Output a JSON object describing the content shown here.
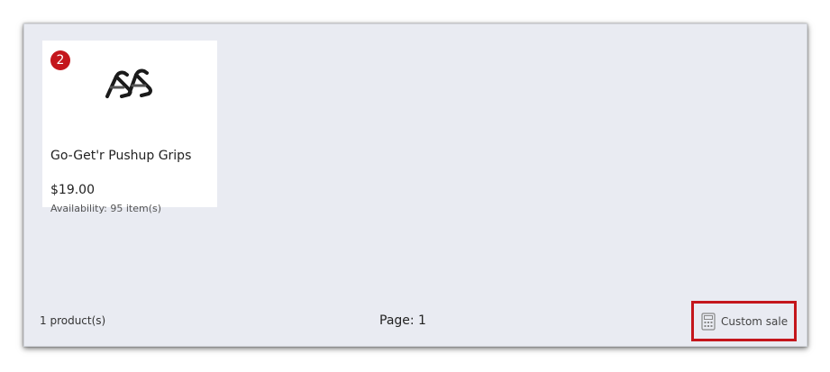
{
  "product": {
    "badge_count": "2",
    "name": "Go-Get'r Pushup Grips",
    "price": "$19.00",
    "availability": "Availability: 95 item(s)",
    "image_icon": "pushup-grips-image"
  },
  "footer": {
    "count": "1 product(s)",
    "page": "Page: 1",
    "custom_sale_label": "Custom sale",
    "custom_sale_icon": "calculator-icon"
  },
  "colors": {
    "badge": "#c4161c",
    "highlight_border": "#c4161c",
    "panel_background": "#e9ebf2"
  }
}
